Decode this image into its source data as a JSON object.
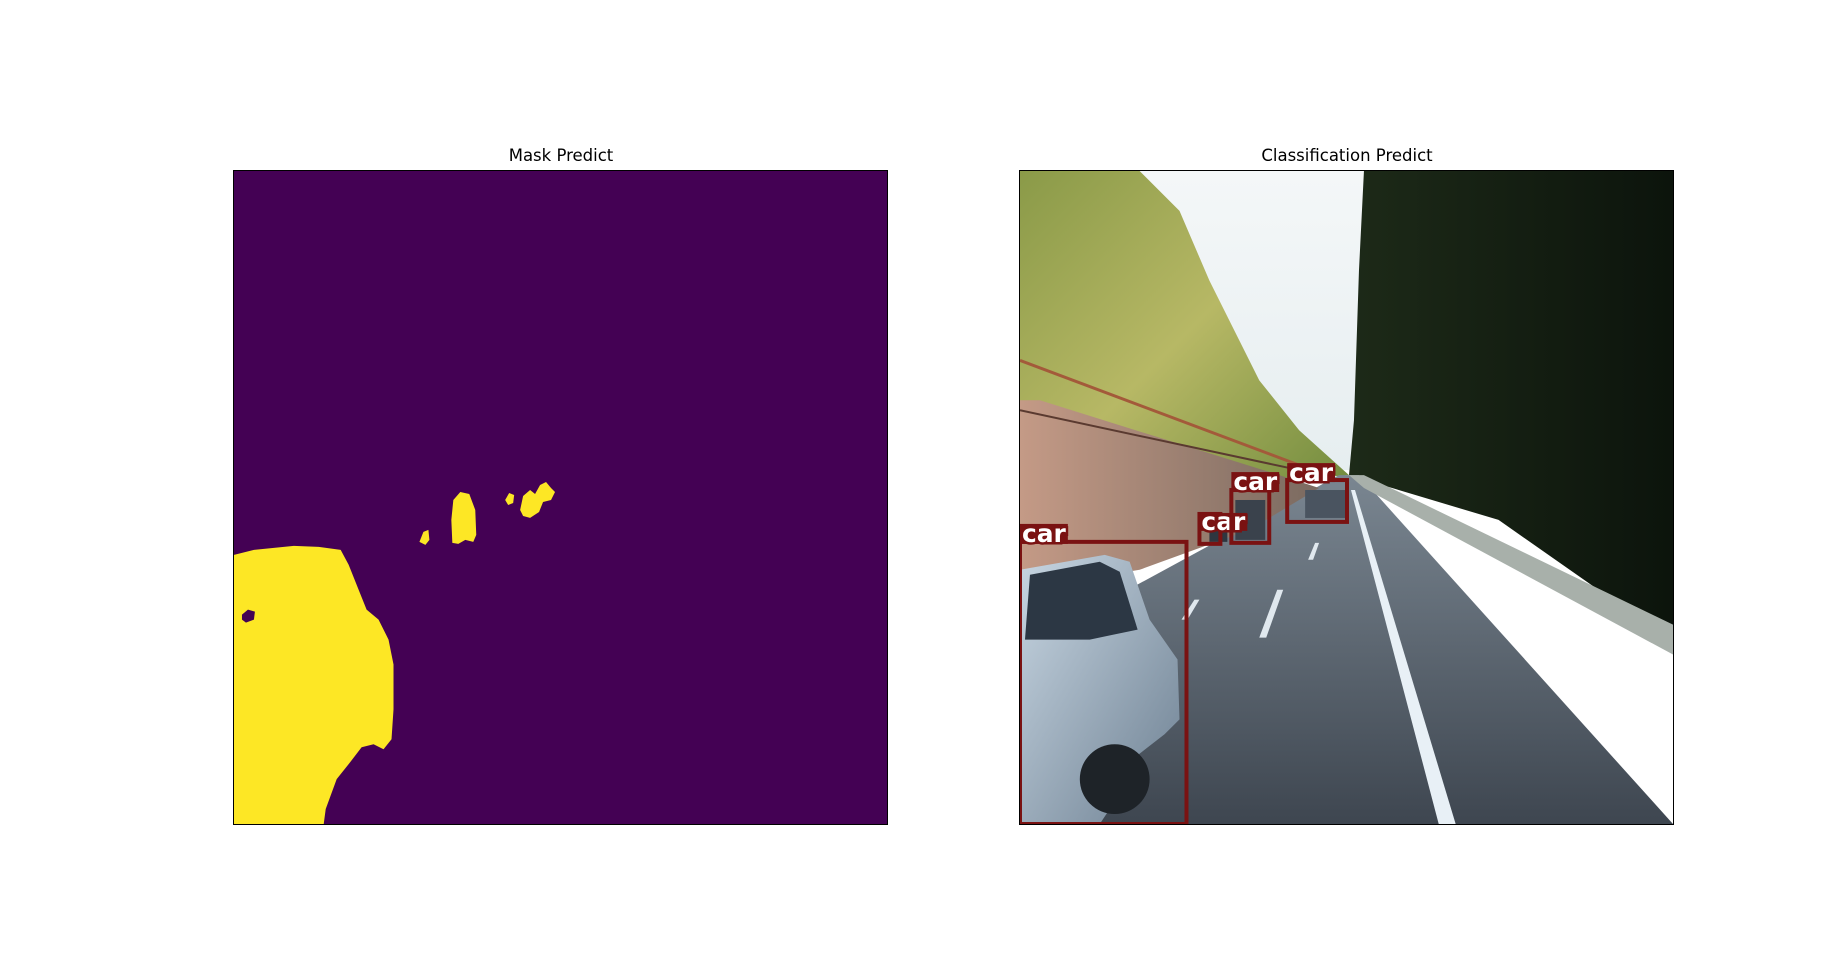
{
  "figure": {
    "panels": [
      {
        "title": "Mask Predict",
        "content": "binary segmentation mask (car pixels highlighted)"
      },
      {
        "title": "Classification Predict",
        "content": "road scene photo with detected vehicles"
      }
    ],
    "colors": {
      "mask_background": "#440154",
      "mask_foreground": "#fde725",
      "detection_box": "#7a1212",
      "detection_label_text": "#ffffff"
    }
  },
  "detections": [
    {
      "label": "car"
    },
    {
      "label": "car"
    },
    {
      "label": "car"
    },
    {
      "label": "car"
    }
  ]
}
